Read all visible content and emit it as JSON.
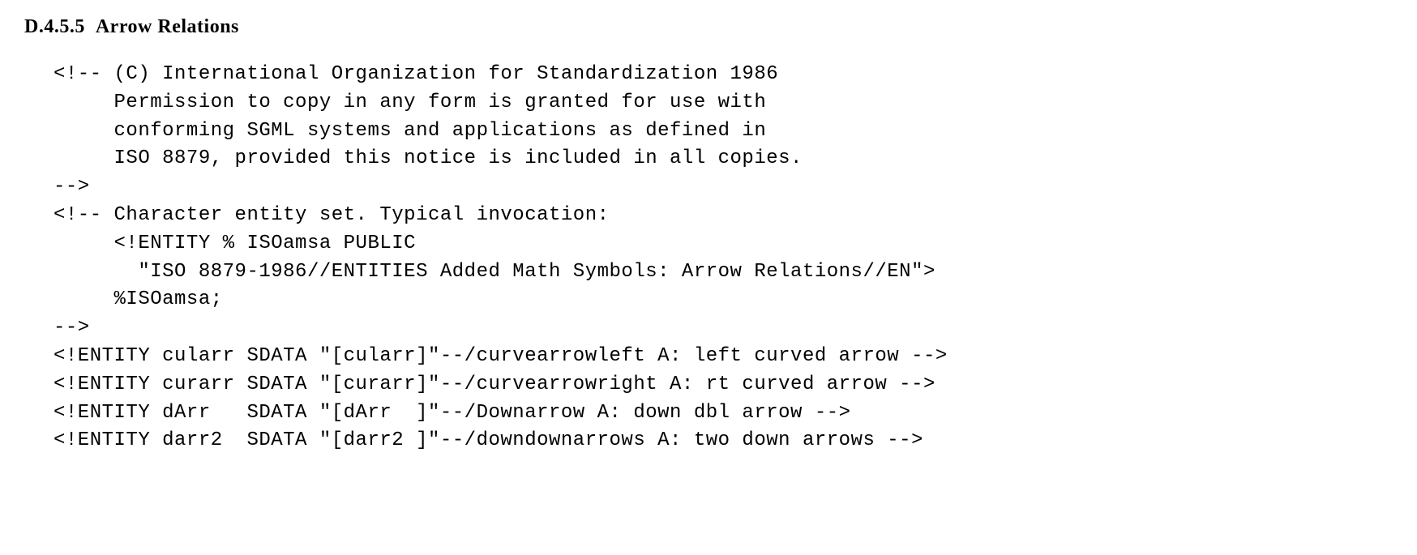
{
  "heading": {
    "number": "D.4.5.5",
    "title": "Arrow Relations"
  },
  "code": {
    "lines": [
      "<!-- (C) International Organization for Standardization 1986",
      "     Permission to copy in any form is granted for use with",
      "     conforming SGML systems and applications as defined in",
      "     ISO 8879, provided this notice is included in all copies.",
      "-->",
      "<!-- Character entity set. Typical invocation:",
      "     <!ENTITY % ISOamsa PUBLIC",
      "       \"ISO 8879-1986//ENTITIES Added Math Symbols: Arrow Relations//EN\">",
      "     %ISOamsa;",
      "-->",
      "<!ENTITY cularr SDATA \"[cularr]\"--/curvearrowleft A: left curved arrow -->",
      "<!ENTITY curarr SDATA \"[curarr]\"--/curvearrowright A: rt curved arrow -->",
      "<!ENTITY dArr   SDATA \"[dArr  ]\"--/Downarrow A: down dbl arrow -->",
      "<!ENTITY darr2  SDATA \"[darr2 ]\"--/downdownarrows A: two down arrows -->"
    ]
  }
}
